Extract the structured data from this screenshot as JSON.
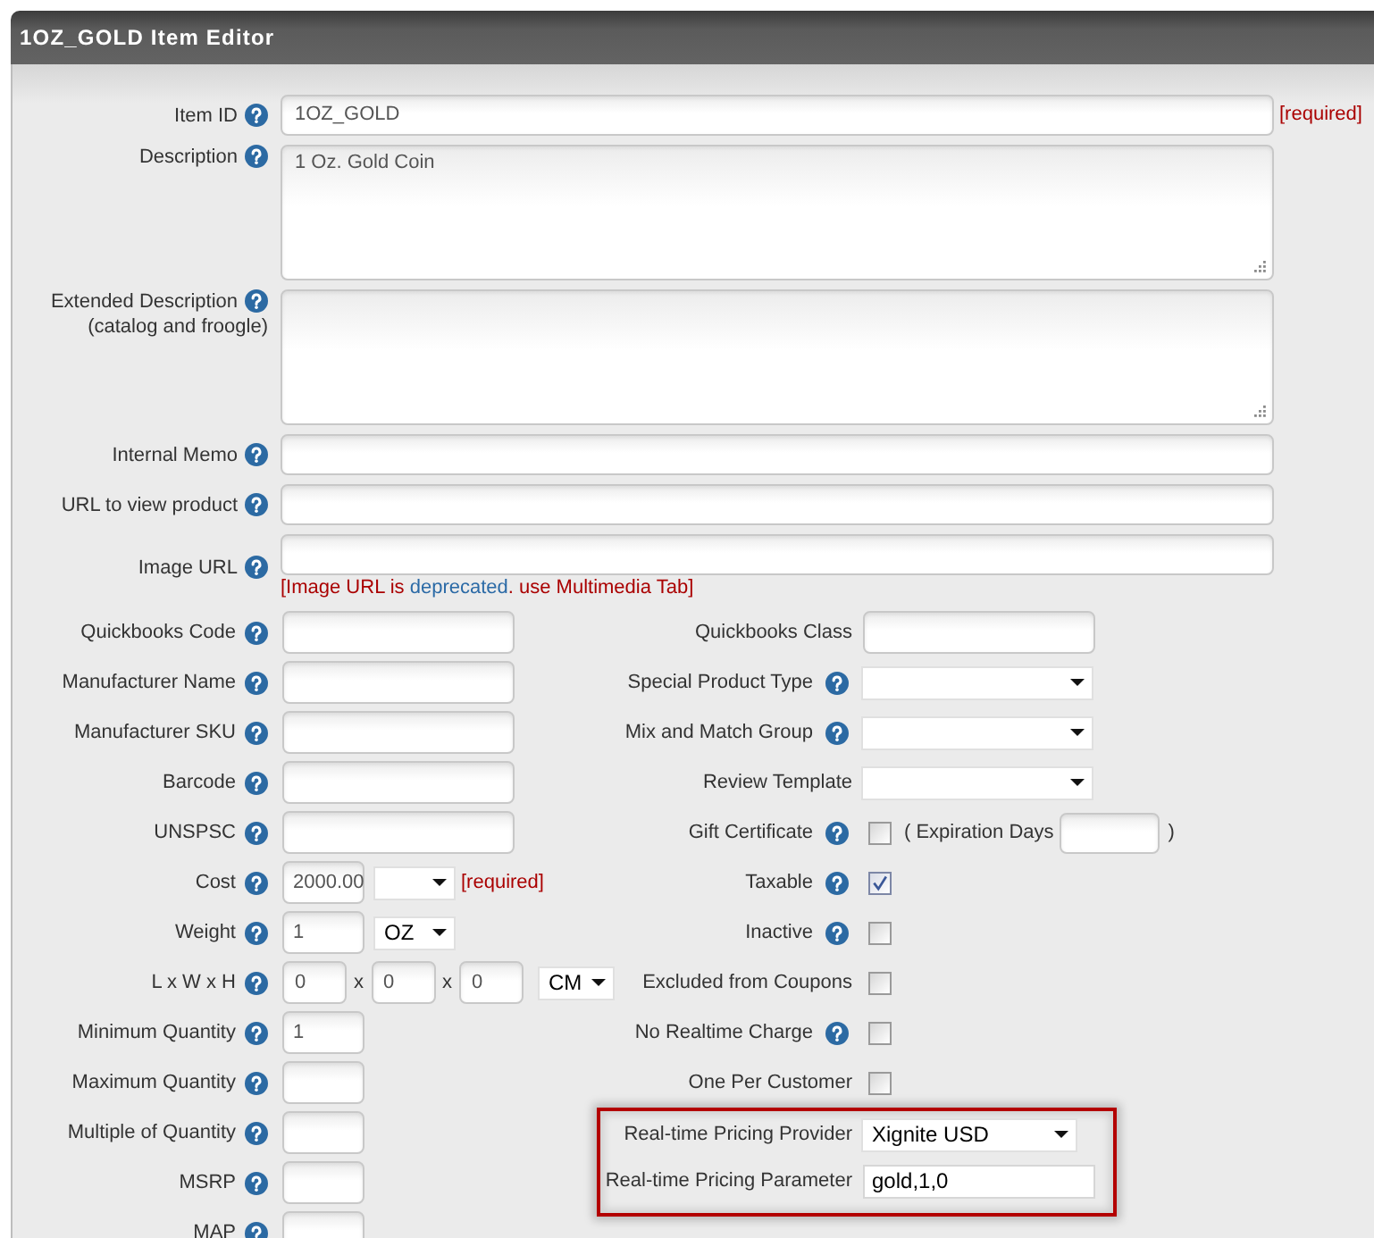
{
  "window": {
    "title": "1OZ_GOLD Item Editor"
  },
  "main_fields": [
    {
      "label": "Item ID",
      "help": true,
      "kind": "input",
      "value": "1OZ_GOLD",
      "required_note": "[required]"
    },
    {
      "label": "Description",
      "help": true,
      "kind": "textarea",
      "value": "1 Oz. Gold Coin"
    },
    {
      "label": "Extended Description",
      "sublabel": "(catalog and froogle)",
      "help": true,
      "kind": "textarea"
    },
    {
      "label": "Internal Memo",
      "help": true,
      "kind": "input"
    },
    {
      "label": "URL to view product",
      "help": true,
      "kind": "input"
    },
    {
      "label": "Image URL",
      "help": true,
      "kind": "input",
      "note_parts": [
        {
          "kind": "text",
          "text": "[Image URL is "
        },
        {
          "kind": "link",
          "text": "deprecated"
        },
        {
          "kind": "text",
          "text": ". use Multimedia Tab]"
        }
      ]
    }
  ],
  "left_fields": [
    {
      "label": "Quickbooks Code",
      "help": true,
      "kind": "text"
    },
    {
      "label": "Manufacturer Name",
      "help": true,
      "kind": "text"
    },
    {
      "label": "Manufacturer SKU",
      "help": true,
      "kind": "text"
    },
    {
      "label": "Barcode",
      "help": true,
      "kind": "text"
    },
    {
      "label": "UNSPSC",
      "help": true,
      "kind": "text"
    },
    {
      "label": "Cost",
      "help": true,
      "kind": "short_unit",
      "value": "2000.00",
      "required_note": "[required]"
    },
    {
      "label": "Weight",
      "help": true,
      "kind": "short_unit",
      "value": "1",
      "unit": "OZ"
    },
    {
      "label": "L x W x H",
      "help": true,
      "kind": "dimensions",
      "values": [
        "0",
        "0",
        "0"
      ],
      "separators": [
        "x",
        "x"
      ],
      "unit": "CM"
    },
    {
      "label": "Minimum Quantity",
      "help": true,
      "kind": "short",
      "value": "1"
    },
    {
      "label": "Maximum Quantity",
      "help": true,
      "kind": "short"
    },
    {
      "label": "Multiple of Quantity",
      "help": true,
      "kind": "short"
    },
    {
      "label": "MSRP",
      "help": true,
      "kind": "short"
    },
    {
      "label": "MAP",
      "help": true,
      "kind": "short"
    }
  ],
  "right_fields": [
    {
      "label": "Quickbooks Class",
      "help": false,
      "kind": "text"
    },
    {
      "label": "Special Product Type",
      "help": true,
      "kind": "select"
    },
    {
      "label": "Mix and Match Group",
      "help": true,
      "kind": "select"
    },
    {
      "label": "Review Template",
      "help": false,
      "kind": "select"
    },
    {
      "label": "Gift Certificate",
      "help": true,
      "kind": "checkbox_days",
      "checked": false,
      "before": "( Expiration Days",
      "after": ")"
    },
    {
      "label": "Taxable",
      "help": true,
      "kind": "checkbox",
      "checked": true
    },
    {
      "label": "Inactive",
      "help": true,
      "kind": "checkbox",
      "checked": false
    },
    {
      "label": "Excluded from Coupons",
      "help": false,
      "kind": "checkbox",
      "checked": false
    },
    {
      "label": "No Realtime Charge",
      "help": true,
      "kind": "checkbox",
      "checked": false
    },
    {
      "label": "One Per Customer",
      "help": false,
      "kind": "checkbox",
      "checked": false
    }
  ],
  "highlighted_fields": [
    {
      "label": "Real-time Pricing Provider",
      "help": false,
      "kind": "select",
      "value": "Xignite USD"
    },
    {
      "label": "Real-time Pricing Parameter",
      "help": false,
      "kind": "plain_input",
      "value": "gold,1,0"
    }
  ]
}
